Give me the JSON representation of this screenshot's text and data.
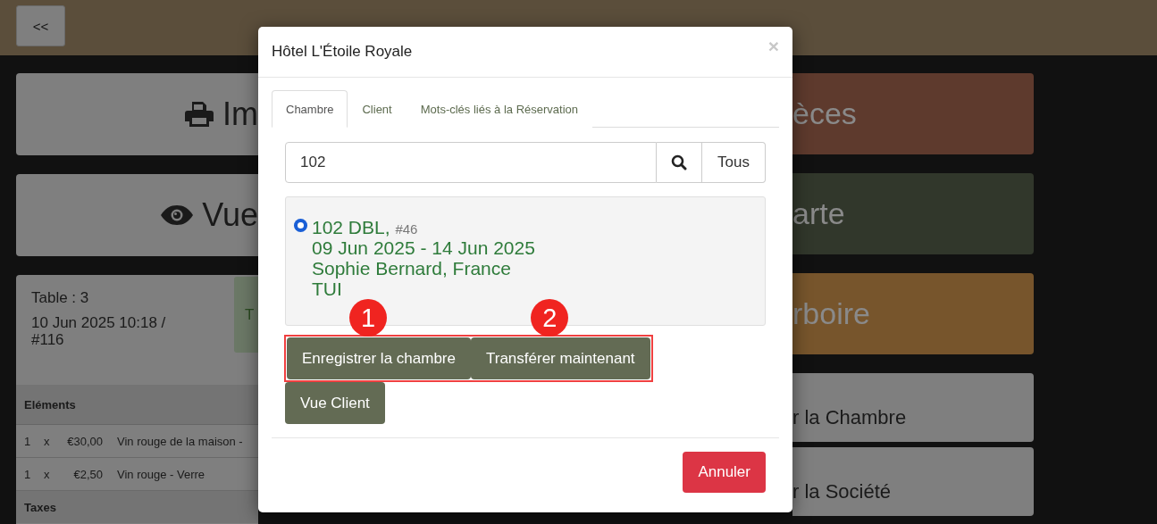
{
  "top_bar": {
    "back_button": "<<"
  },
  "left_panel": {
    "print_button": "Im",
    "view_button": "Vue",
    "order": {
      "table": "Table : 3",
      "datetime": "10 Jun 2025 10:18 / #116",
      "status": "T",
      "items_header": "Eléments",
      "items": [
        {
          "qty": "1",
          "times": "x",
          "price": "€30,00",
          "name": "Vin rouge de la maison -"
        },
        {
          "qty": "1",
          "times": "x",
          "price": "€2,50",
          "name": "Vin rouge - Verre"
        }
      ],
      "taxes_header": "Taxes"
    }
  },
  "right_panel": {
    "buttons": [
      {
        "label": "èces",
        "kind": "large",
        "color": "#5e3a2d"
      },
      {
        "label": "arte",
        "kind": "large",
        "color": "#31372b"
      },
      {
        "label": "rboire",
        "kind": "large",
        "color": "#77552c"
      },
      {
        "label": "r la Chambre",
        "kind": "small",
        "color": "#7f7f7f"
      },
      {
        "label": "r la Société",
        "kind": "small",
        "color": "#7f7f7f"
      }
    ]
  },
  "modal": {
    "title": "Hôtel L'Étoile Royale",
    "close": "×",
    "tabs": [
      {
        "label": "Chambre",
        "selected": true
      },
      {
        "label": "Client",
        "selected": false
      },
      {
        "label": "Mots-clés liés à la Réservation",
        "selected": false
      }
    ],
    "search": {
      "value": "102",
      "all_button": "Tous"
    },
    "results": [
      {
        "selected": true,
        "room": "102 DBL,",
        "ref": "#46",
        "dates": "09 Jun 2025 - 14 Jun 2025",
        "guest": "Sophie Bernard, France",
        "agency": "TUI"
      }
    ],
    "actions": [
      {
        "label": "Enregistrer la chambre",
        "highlighted": true,
        "marker": "1"
      },
      {
        "label": "Transférer maintenant",
        "highlighted": true,
        "marker": "2"
      },
      {
        "label": "Vue Client",
        "highlighted": false
      }
    ],
    "cancel_button": "Annuler"
  }
}
